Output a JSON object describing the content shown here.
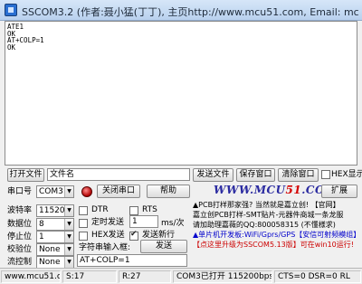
{
  "window": {
    "title": "SSCOM3.2 (作者:聂小猛(丁丁), 主页http://www.mcu51.com,  Email: mc"
  },
  "receive": {
    "text": "ATE1\nOK\nAT+COLP=1\nOK"
  },
  "file_row": {
    "open_file_button": "打开文件",
    "filename_value": "文件名",
    "send_file_button": "发送文件",
    "save_window_button": "保存窗口",
    "clear_window_button": "清除窗口",
    "hex_display_label": "HEX显示"
  },
  "port_row": {
    "port_label": "串口号",
    "port_value": "COM3",
    "close_port_button": "关闭串口",
    "help_button": "帮助",
    "expand_button": "扩展"
  },
  "logo": {
    "prefix": "WWW.MCU",
    "number": "51",
    "suffix": ".COM"
  },
  "settings": {
    "baud_label": "波特率",
    "baud_value": "115200",
    "data_bits_label": "数据位",
    "data_bits_value": "8",
    "stop_bits_label": "停止位",
    "stop_bits_value": "1",
    "parity_label": "校验位",
    "parity_value": "None",
    "flow_label": "流控制",
    "flow_value": "None"
  },
  "options": {
    "dtr_label": "DTR",
    "rts_label": "RTS",
    "timed_send_label": "定时发送",
    "interval_value": "1",
    "interval_unit": "ms/次",
    "hex_send_label": "HEX发送",
    "send_newline_label": "发送新行",
    "string_input_label": "字符串输入框:",
    "send_button": "发送"
  },
  "send_input": {
    "value": "AT+COLP=1"
  },
  "ads": {
    "line1": "▲PCB打样那家强? 当然就是嘉立创! 【官网】",
    "line2": "嘉立创PCB打样-SMT贴片-元器件商城一条龙服",
    "line3": "请加助理嘉薇的QQ:800058315 (不懂様求)",
    "line4": "▲单片机开发板:WiFi/Gprs/GPS【安信可射频模组】",
    "line5": "【点这里升级为SSCOM5.13版】可在win10运行!"
  },
  "status": {
    "site": "www.mcu51.cor",
    "sent": "S:17",
    "received": "R:27",
    "port_status": "COM3已打开  115200bps",
    "line_status": "CTS=0 DSR=0 RL"
  },
  "colors": {
    "logo_blue": "#2a2aa0",
    "logo_red": "#d40000",
    "ad_blue": "#0000cc",
    "ad_red": "#cc0000"
  }
}
